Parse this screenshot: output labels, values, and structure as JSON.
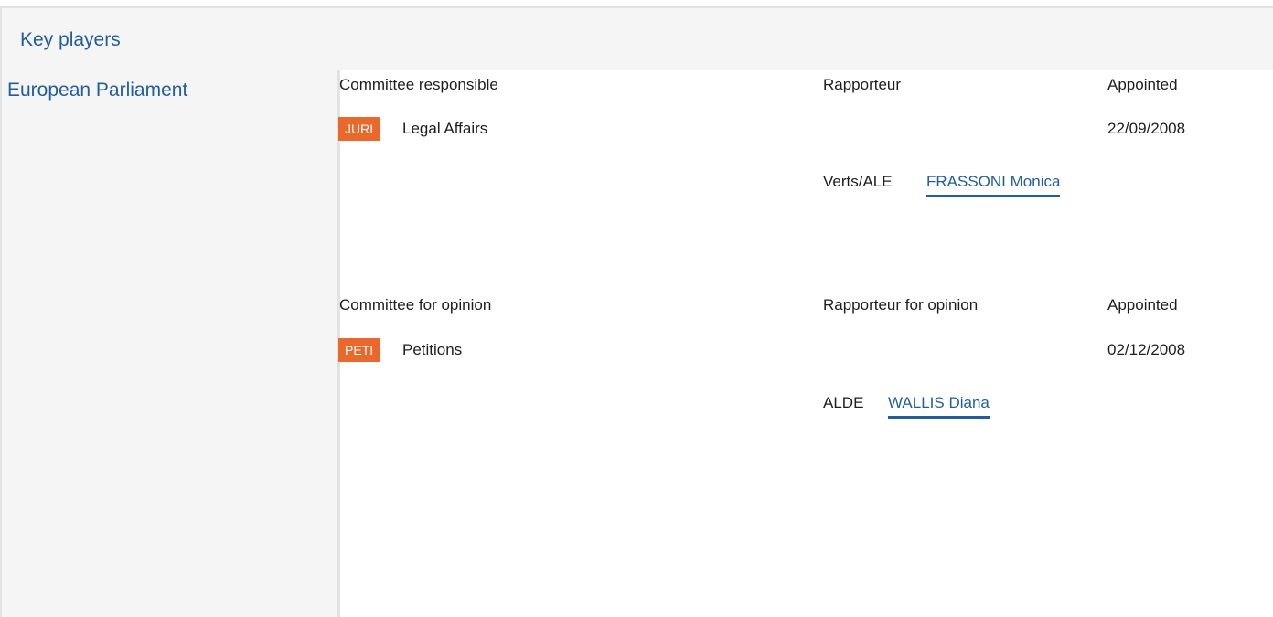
{
  "header": {
    "title": "Key players"
  },
  "sidebar": {
    "title": "European Parliament"
  },
  "responsible": {
    "col_committee": "Committee responsible",
    "col_rapporteur": "Rapporteur",
    "col_appointed": "Appointed",
    "committee": {
      "code": "JURI",
      "name": "Legal Affairs"
    },
    "appointed": "22/09/2008",
    "rapporteur": {
      "group": "Verts/ALE",
      "name": "FRASSONI Monica"
    }
  },
  "opinion": {
    "col_committee": "Committee for opinion",
    "col_rapporteur": "Rapporteur for opinion",
    "col_appointed": "Appointed",
    "committee": {
      "code": "PETI",
      "name": "Petitions"
    },
    "appointed": "02/12/2008",
    "rapporteur": {
      "group": "ALDE",
      "name": "WALLIS Diana"
    }
  },
  "colors": {
    "link": "#235e9c",
    "badge": "#e8692b",
    "panel": "#f5f5f5"
  }
}
